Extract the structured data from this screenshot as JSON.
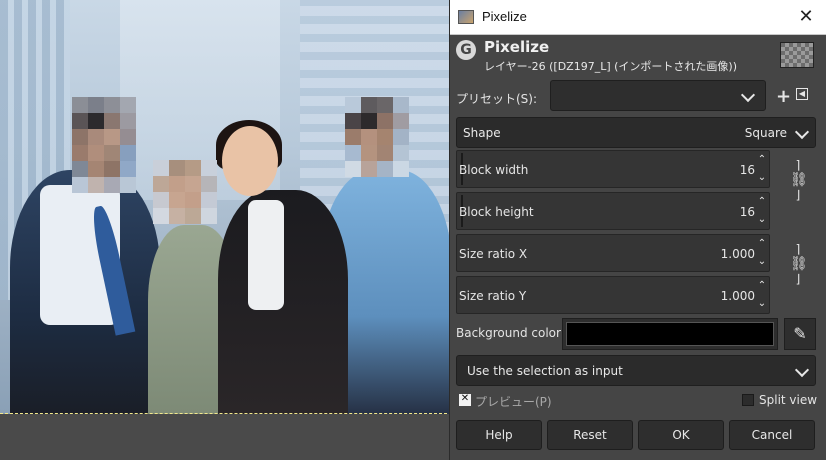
{
  "dialog": {
    "window_title": "Pixelize",
    "filter_title": "Pixelize",
    "layer_subtitle": "レイヤー-26 ([DZ197_L] (インポートされた画像))",
    "close_icon": "close-icon",
    "presets_label": "プリセット(S):",
    "presets_value": "",
    "shape_label": "Shape",
    "shape_value": "Square",
    "block_width_label": "Block width",
    "block_width_value": "16",
    "block_height_label": "Block height",
    "block_height_value": "16",
    "size_ratio_x_label": "Size ratio X",
    "size_ratio_x_value": "1.000",
    "size_ratio_y_label": "Size ratio Y",
    "size_ratio_y_value": "1.000",
    "background_color_label": "Background color",
    "background_color": "#000000",
    "input_mode": "Use the selection as input",
    "preview_label": "プレビュー(P)",
    "preview_checked": true,
    "split_view_label": "Split view",
    "split_view_checked": false,
    "buttons": {
      "help": "Help",
      "reset": "Reset",
      "ok": "OK",
      "cancel": "Cancel"
    }
  },
  "colors": {
    "dialog_bg": "#454545",
    "field_bg": "#2e2e2e",
    "text": "#e6e6e6"
  }
}
